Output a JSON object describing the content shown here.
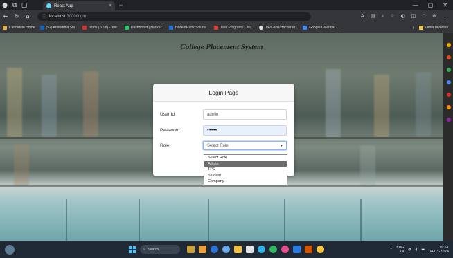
{
  "browser": {
    "tab_title": "React App",
    "tab_close": "×",
    "new_tab": "+",
    "address_host": "localhost",
    "address_path": ":3000/login",
    "bookmarks": [
      {
        "label": "Candidate Home",
        "color": "#e8b04a"
      },
      {
        "label": "(52) Aniruddha Shi...",
        "color": "#0a66c2"
      },
      {
        "label": "Inbox (1098) - anir...",
        "color": "#d93025"
      },
      {
        "label": "Dashboard | Hacker...",
        "color": "#2ec866"
      },
      {
        "label": "HackerRank Solutio...",
        "color": "#1a73e8"
      },
      {
        "label": "Java Programs | Jav...",
        "color": "#e53935"
      },
      {
        "label": "Java-skill/Hackeran...",
        "color": "#e0e0e0"
      },
      {
        "label": "Google Calendar - ...",
        "color": "#4285f4"
      }
    ],
    "bookmarks_overflow": "›",
    "other_bookmarks": "Other favorites"
  },
  "app": {
    "site_title": "College Placement System",
    "login": {
      "heading": "Login Page",
      "user_label": "User Id",
      "user_value": "admin",
      "password_label": "Password",
      "password_value": "•••••",
      "role_label": "Role",
      "role_selected": "Select Role",
      "role_options": [
        "Select Role",
        "Admin",
        "TPO",
        "Student",
        "Company"
      ],
      "highlighted_option": "Admin"
    }
  },
  "taskbar": {
    "search_placeholder": "Search",
    "lang_top": "ENG",
    "lang_bottom": "IN",
    "time": "19:57",
    "date": "04-03-2024"
  },
  "colors": {
    "accent": "#0d6efd",
    "chrome_dark": "#202124",
    "chrome_mid": "#35363a"
  }
}
